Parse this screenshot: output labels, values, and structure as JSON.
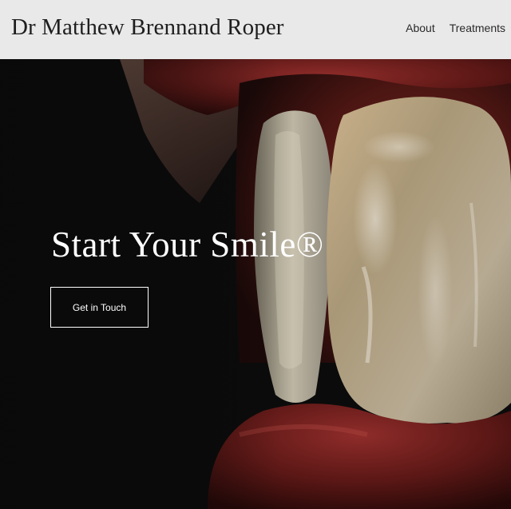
{
  "header": {
    "site_title": "Dr Matthew Brennand Roper",
    "nav": [
      {
        "label": "About"
      },
      {
        "label": "Treatments"
      }
    ]
  },
  "hero": {
    "heading": "Start Your Smile®",
    "cta_label": "Get in Touch",
    "image_subject": "close-up photograph of front teeth and lips"
  },
  "colors": {
    "header_background": "#e9e9e9",
    "title_text": "#1e1e1e",
    "hero_background": "#0b0b0b",
    "hero_text": "#ffffff"
  }
}
